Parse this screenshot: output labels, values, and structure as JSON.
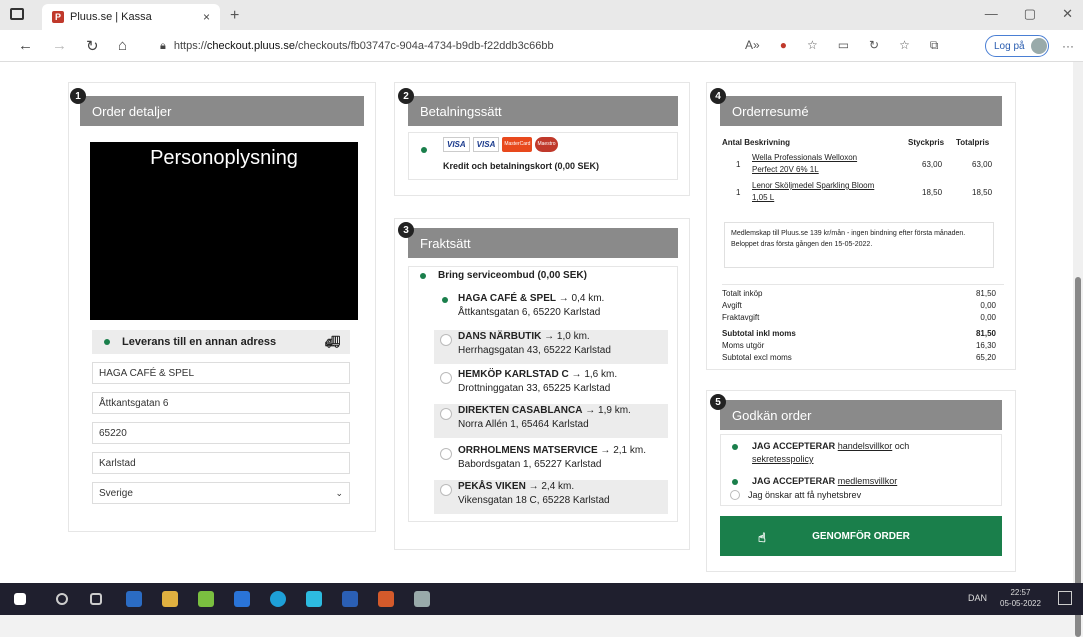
{
  "browser": {
    "tab_title": "Pluus.se | Kassa",
    "tab_close": "×",
    "new_tab": "+",
    "url_prefix": "https://",
    "url_host": "checkout.pluus.se",
    "url_path": "/checkouts/fb03747c-904a-4734-b9db-f22ddb3c66bb",
    "login_label": "Log på",
    "more": "···"
  },
  "order_details": {
    "step": "1",
    "title": "Order detaljer",
    "redacted_label": "Personoplysning",
    "delivery_label": "Leverans till en annan adress",
    "fields": {
      "name": "HAGA CAFÉ & SPEL",
      "street": "Åttkantsgatan 6",
      "zip": "65220",
      "city": "Karlstad",
      "country": "Sverige"
    }
  },
  "payment": {
    "step": "2",
    "title": "Betalningssätt",
    "option_label": "Kredit och betalningskort (0,00 SEK)",
    "card_logos": [
      "VISA",
      "VISA",
      "MasterCard",
      "Maestro"
    ]
  },
  "shipping": {
    "step": "3",
    "title": "Fraktsätt",
    "carrier": "Bring serviceombud (0,00 SEK)",
    "pickup_points": [
      {
        "name": "HAGA CAFÉ & SPEL",
        "arrow": "→",
        "dist": "0,4 km.",
        "addr": "Åttkantsgatan 6, 65220 Karlstad",
        "selected": true
      },
      {
        "name": "DANS NÄRBUTIK",
        "arrow": "→",
        "dist": "1,0 km.",
        "addr": "Herrhagsgatan 43, 65222 Karlstad",
        "selected": false
      },
      {
        "name": "HEMKÖP KARLSTAD C",
        "arrow": "→",
        "dist": "1,6 km.",
        "addr": "Drottninggatan 33, 65225 Karlstad",
        "selected": false
      },
      {
        "name": "DIREKTEN CASABLANCA",
        "arrow": "→",
        "dist": "1,9 km.",
        "addr": "Norra Allén 1, 65464 Karlstad",
        "selected": false
      },
      {
        "name": "ORRHOLMENS MATSERVICE",
        "arrow": "→",
        "dist": "2,1 km.",
        "addr": "Babordsgatan 1, 65227 Karlstad",
        "selected": false
      },
      {
        "name": "PEKÅS VIKEN",
        "arrow": "→",
        "dist": "2,4 km.",
        "addr": "Vikensgatan 18 C, 65228 Karlstad",
        "selected": false
      }
    ]
  },
  "summary": {
    "step": "4",
    "title": "Orderresumé",
    "headers": {
      "qty": "Antal",
      "desc": "Beskrivning",
      "unit": "Styckpris",
      "total": "Totalpris"
    },
    "items": [
      {
        "qty": "1",
        "desc1": "Wella Professionals Welloxon",
        "desc2": "Perfect 20V 6% 1L",
        "unit": "63,00",
        "total": "63,00"
      },
      {
        "qty": "1",
        "desc1": "Lenor Sköljmedel Sparkling Bloom",
        "desc2": "1,05 L",
        "unit": "18,50",
        "total": "18,50"
      }
    ],
    "membership_note": "Medlemskap till Pluus.se 139 kr/mån - ingen bindning efter första månaden. Beloppet dras första gången den 15-05-2022.",
    "totals": [
      {
        "label": "Totalt inköp",
        "value": "81,50",
        "bold": false
      },
      {
        "label": "Avgift",
        "value": "0,00",
        "bold": false
      },
      {
        "label": "Fraktavgift",
        "value": "0,00",
        "bold": false
      },
      {
        "label": "Subtotal inkl moms",
        "value": "81,50",
        "bold": true
      },
      {
        "label": "Moms utgör",
        "value": "16,30",
        "bold": false
      },
      {
        "label": "Subtotal excl moms",
        "value": "65,20",
        "bold": false
      }
    ]
  },
  "approve": {
    "step": "5",
    "title": "Godkän order",
    "accept1_prefix": "JAG ACCEPTERAR",
    "accept1_link": "handelsvillkor",
    "accept1_mid": "och",
    "accept1_link2": "sekretesspolicy",
    "accept2_prefix": "JAG ACCEPTERAR",
    "accept2_link": "medlemsvillkor",
    "newsletter": "Jag önskar att få nyhetsbrev",
    "submit": "GENOMFÖR ORDER"
  },
  "taskbar": {
    "lang": "DAN",
    "time": "22:57",
    "date": "05-05-2022"
  },
  "colors": {
    "accent": "#1a7f4b",
    "header_grey": "#8a8a8a"
  }
}
